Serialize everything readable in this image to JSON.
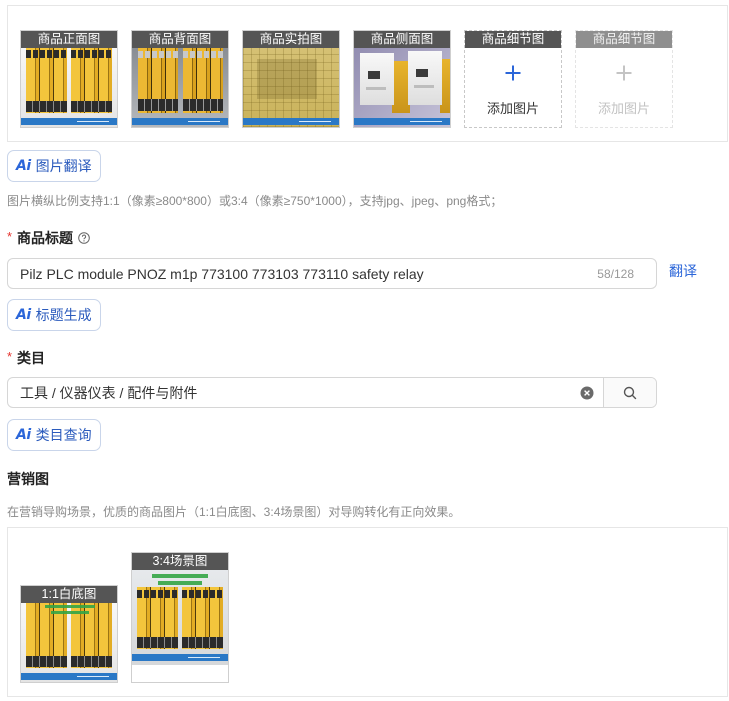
{
  "main_images": {
    "slots": [
      {
        "label": "商品正面图"
      },
      {
        "label": "商品背面图"
      },
      {
        "label": "商品实拍图"
      },
      {
        "label": "商品侧面图"
      },
      {
        "label": "商品细节图",
        "add_label": "添加图片",
        "icon": "plus-icon",
        "disabled": false
      },
      {
        "label": "商品细节图",
        "add_label": "添加图片",
        "icon": "plus-icon",
        "disabled": true
      }
    ]
  },
  "image_translate_button": {
    "ai_mark": "Ai",
    "label": "图片翻译"
  },
  "image_hint": "图片横纵比例支持1:1（像素≥800*800）或3:4（像素≥750*1000），支持jpg、jpeg、png格式；",
  "title_field": {
    "required_mark": "*",
    "label": "商品标题",
    "help_icon": "question-circle-icon",
    "value": "Pilz PLC module PNOZ m1p 773100 773103 773110 safety relay",
    "counter": "58/128",
    "translate_link": "翻译"
  },
  "title_generate_button": {
    "ai_mark": "Ai",
    "label": "标题生成"
  },
  "category_field": {
    "required_mark": "*",
    "label": "类目",
    "value": "工具 / 仪器仪表 / 配件与附件",
    "clear_icon": "close-circle-icon",
    "search_icon": "search-icon"
  },
  "category_query_button": {
    "ai_mark": "Ai",
    "label": "类目查询"
  },
  "marketing": {
    "heading": "营销图",
    "hint": "在营销导购场景，优质的商品图片（1:1白底图、3:4场景图）对导购转化有正向效果。",
    "slots": [
      {
        "label": "1:1白底图"
      },
      {
        "label": "3:4场景图"
      }
    ]
  },
  "colors": {
    "accent": "#2b66d9",
    "required": "#e5322d",
    "label_bar": "#555555",
    "muted_text": "#8a8a8a",
    "border": "#d6d6d6"
  }
}
